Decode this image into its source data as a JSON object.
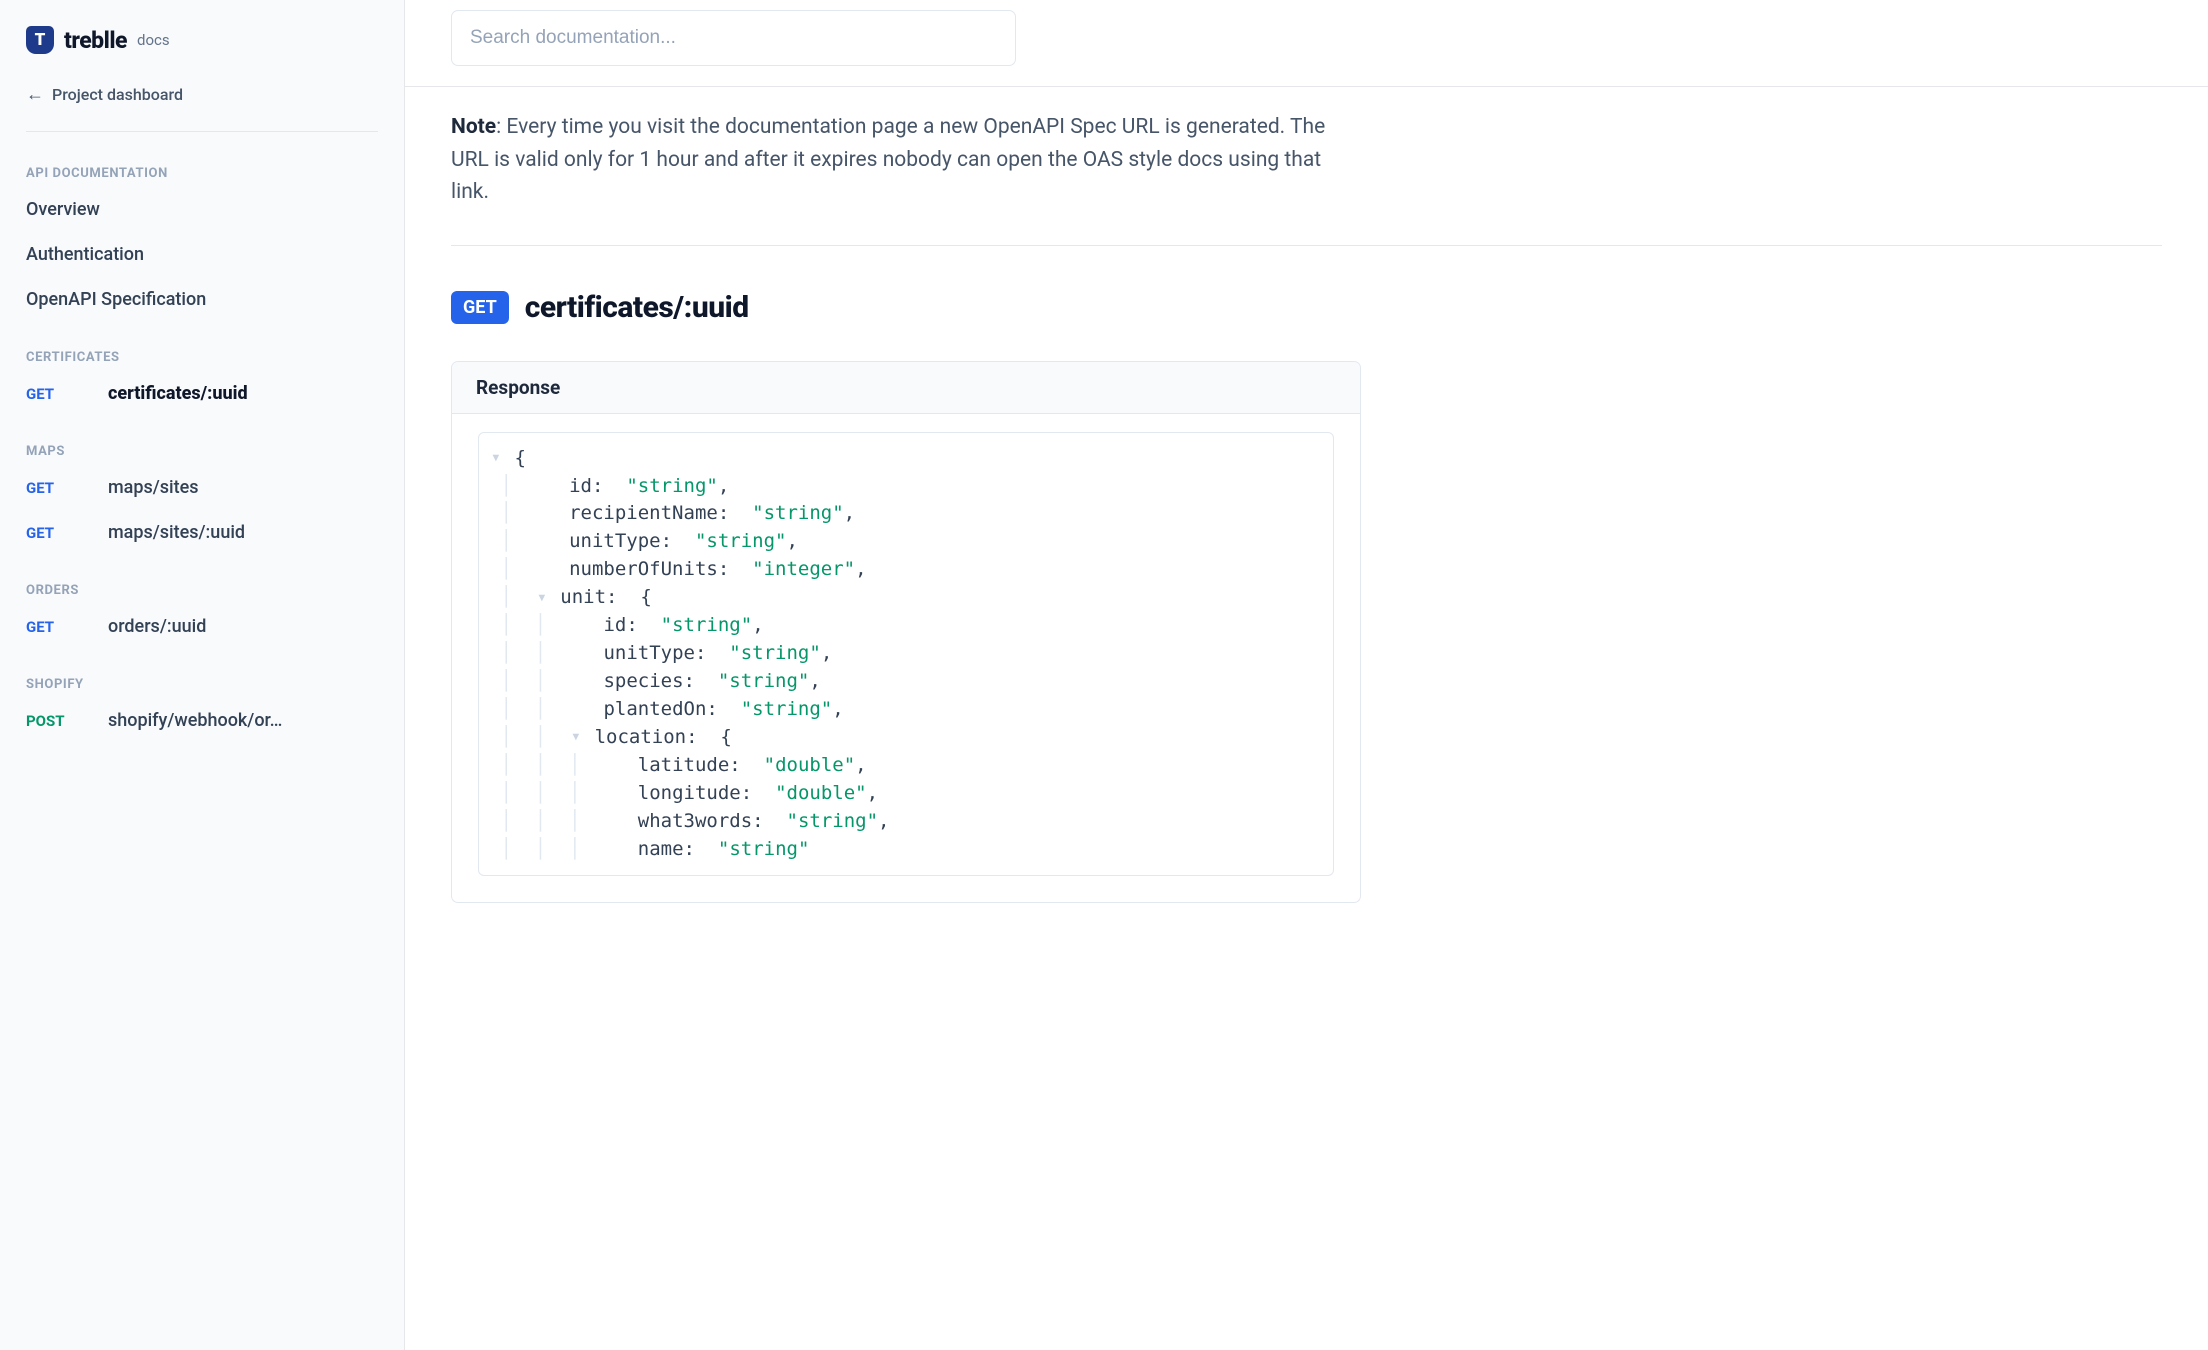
{
  "brand": {
    "name": "treblle",
    "suffix": "docs",
    "logo_letter": "T"
  },
  "back_link": {
    "label": "Project dashboard"
  },
  "sections": {
    "api_doc_label": "API DOCUMENTATION",
    "api_doc_items": {
      "overview": "Overview",
      "auth": "Authentication",
      "oas": "OpenAPI Specification"
    },
    "certificates_label": "CERTIFICATES",
    "certificates": [
      {
        "method": "GET",
        "path": "certificates/:uuid",
        "active": true
      }
    ],
    "maps_label": "MAPS",
    "maps": [
      {
        "method": "GET",
        "path": "maps/sites"
      },
      {
        "method": "GET",
        "path": "maps/sites/:uuid"
      }
    ],
    "orders_label": "ORDERS",
    "orders": [
      {
        "method": "GET",
        "path": "orders/:uuid"
      }
    ],
    "shopify_label": "SHOPIFY",
    "shopify": [
      {
        "method": "POST",
        "path": "shopify/webhook/or…"
      }
    ]
  },
  "search": {
    "placeholder": "Search documentation..."
  },
  "note": {
    "label": "Note",
    "text": ": Every time you visit the documentation page a new OpenAPI Spec URL is generated. The URL is valid only for 1 hour and after it expires nobody can open the OAS style docs using that link."
  },
  "endpoint": {
    "method": "GET",
    "title": "certificates/:uuid"
  },
  "response": {
    "header": "Response",
    "schema": {
      "id": "string",
      "recipientName": "string",
      "unitType": "string",
      "numberOfUnits": "integer",
      "unit": {
        "id": "string",
        "unitType": "string",
        "species": "string",
        "plantedOn": "string",
        "location": {
          "latitude": "double",
          "longitude": "double",
          "what3words": "string",
          "name": "string"
        }
      }
    }
  }
}
